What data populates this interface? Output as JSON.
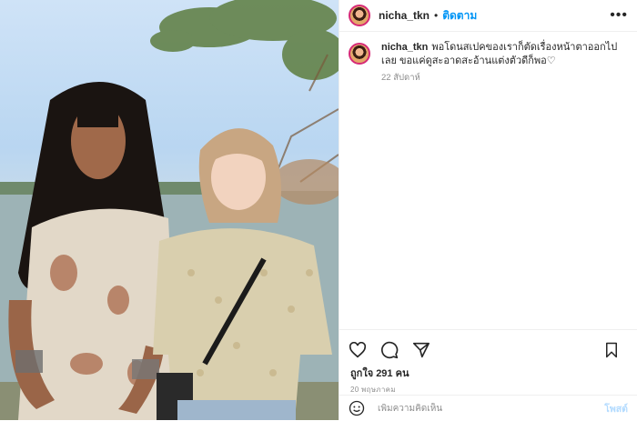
{
  "post": {
    "username": "nicha_tkn",
    "follow_label": "ติดตาม",
    "dot": "•",
    "more_label": "•••",
    "caption_username": "nicha_tkn",
    "caption_text": "พอโดนสเปคของเราก็ตัดเรื่องหน้าตาออกไปเลย ขอแค่ดูสะอาดสะอ้านแต่งตัวดีก็พอ♡",
    "caption_time": "22 สัปดาห์",
    "likes_label": "ถูกใจ 291 คน",
    "date_label": "20 พฤษภาคม",
    "comment_placeholder": "เพิ่มความคิดเห็น",
    "post_label": "โพสต์"
  },
  "icons": {
    "like": "heart-icon",
    "comment": "comment-icon",
    "share": "share-icon",
    "save": "bookmark-icon",
    "emoji": "emoji-icon"
  },
  "colors": {
    "follow": "#0095f6",
    "post_disabled": "#b3dbff",
    "secondary_text": "#8e8e8e"
  }
}
